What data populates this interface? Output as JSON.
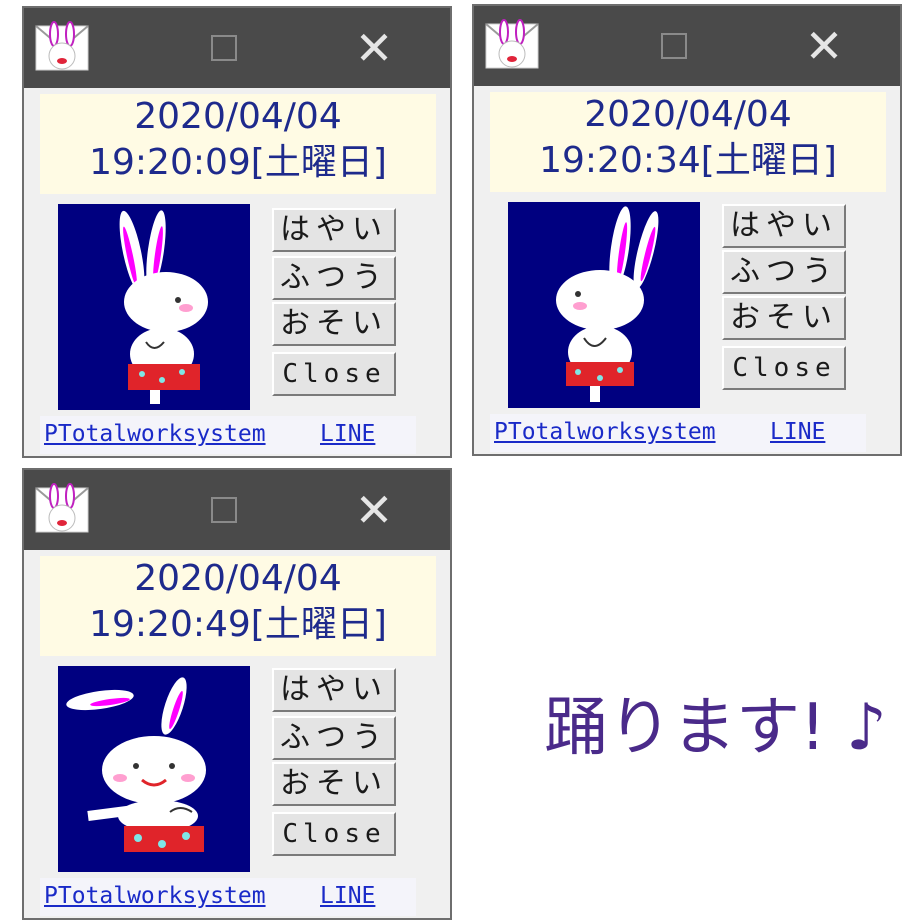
{
  "windows": [
    {
      "date": "2020/04/04",
      "time": "19:20:09[土曜日]",
      "frame": "standing"
    },
    {
      "date": "2020/04/04",
      "time": "19:20:34[土曜日]",
      "frame": "turning"
    },
    {
      "date": "2020/04/04",
      "time": "19:20:49[土曜日]",
      "frame": "dancing"
    }
  ],
  "titlebar": {
    "maximize_icon": "square-icon",
    "close_icon": "close-icon",
    "close_glyph": "✕"
  },
  "buttons": {
    "fast": "はやい",
    "normal": "ふつう",
    "slow": "おそい",
    "close": "Close"
  },
  "links": {
    "ptotal": "PTotalworksystem",
    "line": "LINE"
  },
  "caption": "踊ります! ♪",
  "colors": {
    "titlebar": "#4a4a4a",
    "date_bg": "#fffbe4",
    "date_text": "#1e2a8c",
    "anim_bg": "#000080",
    "link": "#1a2ac8",
    "caption": "#4a2a8a"
  }
}
